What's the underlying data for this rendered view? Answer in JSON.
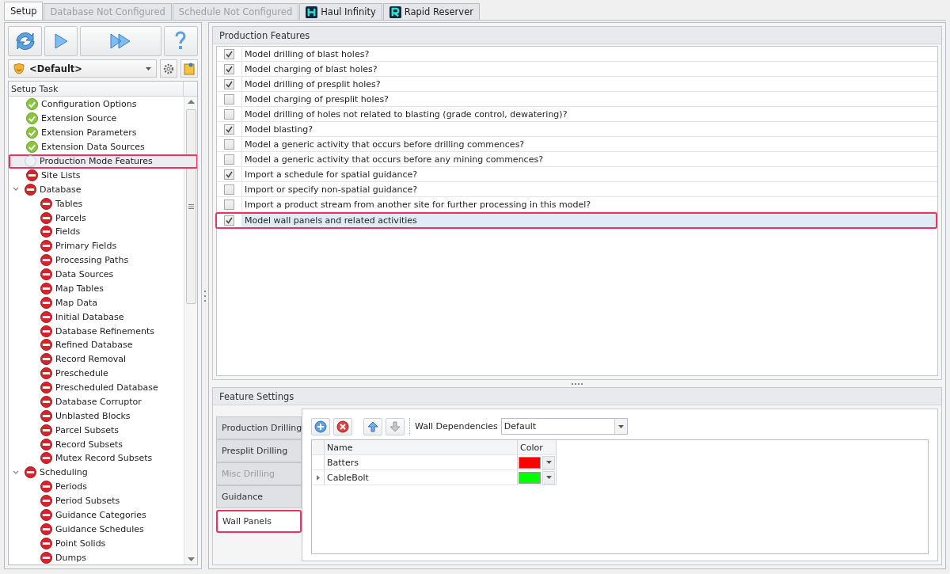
{
  "tabs": [
    {
      "label": "Setup",
      "selected": true,
      "disabled": false,
      "kind": "plain"
    },
    {
      "label": "Database Not Configured",
      "selected": false,
      "disabled": true,
      "kind": "plain"
    },
    {
      "label": "Schedule Not Configured",
      "selected": false,
      "disabled": true,
      "kind": "plain"
    },
    {
      "label": "Haul Infinity",
      "selected": false,
      "disabled": false,
      "kind": "app"
    },
    {
      "label": "Rapid Reserver",
      "selected": false,
      "disabled": false,
      "kind": "app"
    }
  ],
  "sidebar": {
    "profile": {
      "value": "<Default>"
    },
    "tree_header": "Setup Task",
    "items": [
      {
        "label": "Configuration Options",
        "kind": "done",
        "selected": false
      },
      {
        "label": "Extension Source",
        "kind": "done",
        "selected": false
      },
      {
        "label": "Extension Parameters",
        "kind": "done",
        "selected": false
      },
      {
        "label": "Extension Data Sources",
        "kind": "done",
        "selected": false
      },
      {
        "label": "Production Mode Features",
        "kind": "pending",
        "selected": true
      },
      {
        "label": "Site Lists",
        "kind": "error",
        "selected": false
      },
      {
        "label": "Database",
        "kind": "error",
        "selected": false,
        "expanded": true,
        "children": [
          {
            "label": "Tables",
            "kind": "error",
            "selected": false
          },
          {
            "label": "Parcels",
            "kind": "error",
            "selected": false
          },
          {
            "label": "Fields",
            "kind": "error",
            "selected": false
          },
          {
            "label": "Primary Fields",
            "kind": "error",
            "selected": false
          },
          {
            "label": "Processing Paths",
            "kind": "error",
            "selected": false
          },
          {
            "label": "Data Sources",
            "kind": "error",
            "selected": false
          },
          {
            "label": "Map Tables",
            "kind": "error",
            "selected": false
          },
          {
            "label": "Map Data",
            "kind": "error",
            "selected": false
          },
          {
            "label": "Initial Database",
            "kind": "error",
            "selected": false
          },
          {
            "label": "Database Refinements",
            "kind": "error",
            "selected": false
          },
          {
            "label": "Refined Database",
            "kind": "error",
            "selected": false
          },
          {
            "label": "Record Removal",
            "kind": "error",
            "selected": false
          },
          {
            "label": "Preschedule",
            "kind": "error",
            "selected": false
          },
          {
            "label": "Prescheduled Database",
            "kind": "error",
            "selected": false
          },
          {
            "label": "Database Corruptor",
            "kind": "error",
            "selected": false
          },
          {
            "label": "Unblasted Blocks",
            "kind": "error",
            "selected": false
          },
          {
            "label": "Parcel Subsets",
            "kind": "error",
            "selected": false
          },
          {
            "label": "Record Subsets",
            "kind": "error",
            "selected": false
          },
          {
            "label": "Mutex Record Subsets",
            "kind": "error",
            "selected": false
          }
        ]
      },
      {
        "label": "Scheduling",
        "kind": "error",
        "selected": false,
        "expanded": true,
        "children": [
          {
            "label": "Periods",
            "kind": "error",
            "selected": false
          },
          {
            "label": "Period Subsets",
            "kind": "error",
            "selected": false
          },
          {
            "label": "Guidance Categories",
            "kind": "error",
            "selected": false
          },
          {
            "label": "Guidance Schedules",
            "kind": "error",
            "selected": false
          },
          {
            "label": "Point Solids",
            "kind": "error",
            "selected": false
          },
          {
            "label": "Dumps",
            "kind": "error",
            "selected": false
          }
        ]
      }
    ]
  },
  "production_features": {
    "title": "Production Features",
    "items": [
      {
        "label": "Model drilling of blast holes?",
        "checked": true,
        "selected": false
      },
      {
        "label": "Model charging of blast holes?",
        "checked": true,
        "selected": false
      },
      {
        "label": "Model drilling of presplit holes?",
        "checked": true,
        "selected": false
      },
      {
        "label": "Model charging of presplit holes?",
        "checked": false,
        "selected": false
      },
      {
        "label": "Model drilling of holes not related to blasting (grade control, dewatering)?",
        "checked": false,
        "selected": false
      },
      {
        "label": "Model blasting?",
        "checked": true,
        "selected": false
      },
      {
        "label": "Model a generic activity that occurs before drilling commences?",
        "checked": false,
        "selected": false
      },
      {
        "label": "Model a generic activity that occurs before any mining commences?",
        "checked": false,
        "selected": false
      },
      {
        "label": "Import a schedule for spatial guidance?",
        "checked": true,
        "selected": false
      },
      {
        "label": "Import or specify non-spatial guidance?",
        "checked": false,
        "selected": false
      },
      {
        "label": "Import a product stream from another site for further processing in this model?",
        "checked": false,
        "selected": false
      },
      {
        "label": "Model wall panels and related activities",
        "checked": true,
        "selected": true
      }
    ]
  },
  "feature_settings": {
    "title": "Feature Settings",
    "tabs": [
      {
        "label": "Production Drilling",
        "selected": false,
        "disabled": false
      },
      {
        "label": "Presplit Drilling",
        "selected": false,
        "disabled": false
      },
      {
        "label": "Misc Drilling",
        "selected": false,
        "disabled": true
      },
      {
        "label": "Guidance",
        "selected": false,
        "disabled": false
      },
      {
        "label": "Wall Panels",
        "selected": true,
        "disabled": false
      }
    ],
    "wall_dependencies": {
      "label": "Wall Dependencies",
      "value": "Default"
    },
    "move_down_disabled": true,
    "table": {
      "columns": [
        "Name",
        "Color"
      ],
      "rows": [
        {
          "name": "Batters",
          "color": "#ff0000",
          "current": false
        },
        {
          "name": "CableBolt",
          "color": "#00ff00",
          "current": true
        }
      ]
    }
  }
}
